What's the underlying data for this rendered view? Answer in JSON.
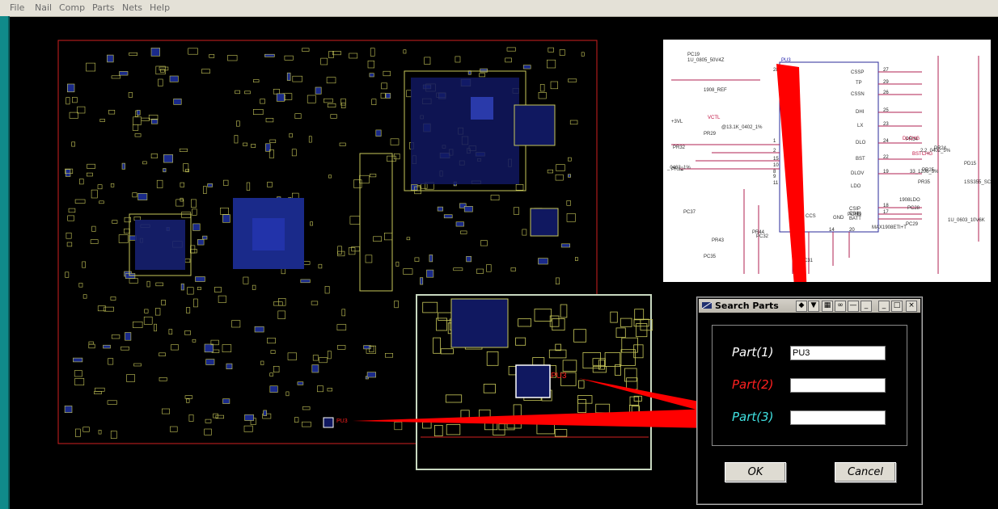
{
  "menu": [
    "File",
    "Nail",
    "Comp",
    "Parts",
    "Nets",
    "Help"
  ],
  "board": {
    "part_labels": [
      "PU3",
      "PU3"
    ],
    "colors": {
      "outline": "#d02020",
      "traces": "#c8c85a",
      "chips": "#2a3aaa",
      "zoom_border": "#c8d8c0",
      "arrow": "#ff0000"
    }
  },
  "schematic": {
    "labels": [
      "PC19",
      "1U_0805_50V4Z",
      "PU3",
      "1908_REF",
      "+3VL",
      "PR29",
      "PR32",
      "PR22",
      "PR24",
      "PR25",
      "PR34",
      "PR35",
      "PR43",
      "PR44",
      "PC28",
      "PC29",
      "PC31",
      "PC32",
      "PC35",
      "PC37",
      "PD15",
      "1908LDO",
      "VCTL",
      "DLCHG",
      "BSTCHG",
      "CSSP",
      "TP",
      "CSSN",
      "DHI",
      "LX",
      "DLO",
      "BST",
      "DLOV",
      "LDO",
      "CSIP",
      "CSIN",
      "BATT",
      "CCS",
      "GND",
      "PGND",
      "MAX1908ETI+T",
      "2.2_0402_5%",
      "33_1206_5%",
      "1SS355_SC",
      "1U_0603_10V6K",
      "@13.1K_0402_1%",
      "_0402_1%"
    ],
    "pin_numbers": [
      "27",
      "29",
      "26",
      "25",
      "23",
      "24",
      "22",
      "19",
      "18",
      "17",
      "28",
      "1",
      "2",
      "14",
      "20",
      "8",
      "9",
      "11",
      "15",
      "10"
    ]
  },
  "dialog": {
    "title": "Search Parts",
    "fields": [
      {
        "label": "Part(1)",
        "value": "PU3",
        "color": "#ffffff"
      },
      {
        "label": "Part(2)",
        "value": "",
        "color": "#ff2020"
      },
      {
        "label": "Part(3)",
        "value": "",
        "color": "#40e0e0"
      }
    ],
    "ok_label": "OK",
    "cancel_label": "Cancel",
    "title_buttons": [
      "arrows-icon",
      "arrows-down-icon",
      "grid-icon",
      "link-icon",
      "minus-icon",
      "underline-icon",
      "minimize-icon",
      "maximize-icon",
      "close-icon"
    ]
  }
}
